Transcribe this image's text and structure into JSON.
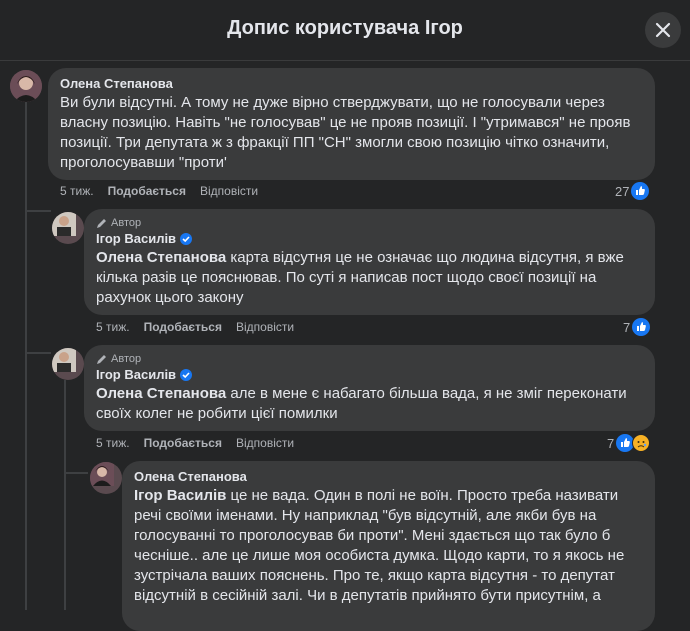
{
  "header": {
    "title": "Допис користувача Ігор"
  },
  "comments": [
    {
      "author": "Олена Степанова",
      "text": "Ви були відсутні. А тому не дуже вірно стверджувати, що не голосували через власну позицію. Навіть \"не голосував\" це не прояв позиції. І \"утримався\" не прояв позиції. Три депутата ж з фракції ПП \"СН\" змогли свою позицію чітко означити, проголосувавши \"проти'",
      "time": "5 тиж.",
      "like": "Подобається",
      "reply": "Відповісти",
      "reactions": "27"
    },
    {
      "badge": "Автор",
      "author": "Ігор Василів",
      "mention": "Олена Степанова",
      "text": " карта відсутня це не означає що людина відсутня, я вже кілька разів це пояснював. По суті я написав пост щодо своєї позиції на рахунок цього закону",
      "time": "5 тиж.",
      "like": "Подобається",
      "reply": "Відповісти",
      "reactions": "7"
    },
    {
      "badge": "Автор",
      "author": "Ігор Василів",
      "mention": "Олена Степанова",
      "text": " але в мене є набагато більша вада, я не зміг переконати своїх колег не робити цієї помилки",
      "time": "5 тиж.",
      "like": "Подобається",
      "reply": "Відповісти",
      "reactions": "7"
    },
    {
      "author": "Олена Степанова",
      "mention": "Ігор Василів",
      "text": " це не вада. Один в полі не воїн. Просто треба називати речі своїми іменами. Ну наприклад \"був відсутній, але якби був на голосуванні то проголосував би проти\". Мені здається що так було б чесніше.. але це лише моя особиста думка. Щодо карти, то я якось не зустрічала ваших пояснень. Про те, якщо карта відсутня - то депутат відсутній в сесійній залі. Чи в депутатів прийнято бути присутнім, а"
    }
  ],
  "colors": {
    "like": "#1877f2",
    "sad": "#f7b125",
    "background": "#242526",
    "bubble": "#3a3b3c"
  }
}
